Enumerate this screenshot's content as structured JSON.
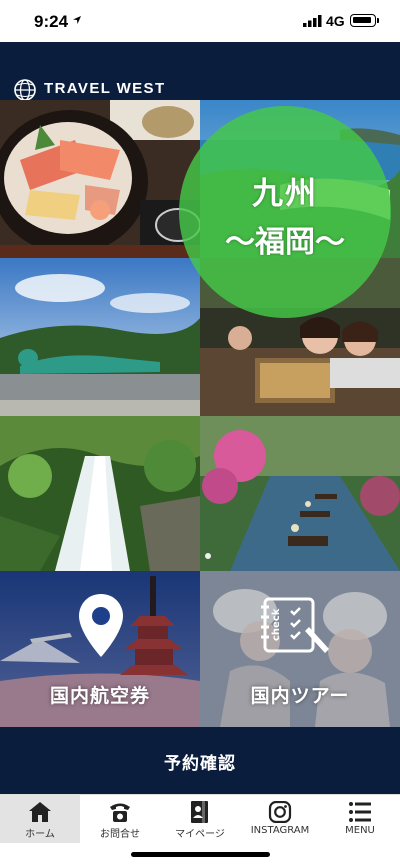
{
  "status_bar": {
    "time": "9:24",
    "network": "4G"
  },
  "header": {
    "logo_text": "TRAVEL WEST"
  },
  "hero": {
    "region_line1": "九州",
    "region_line2": "～福岡～"
  },
  "actions": {
    "domestic_air": "国内航空券",
    "domestic_tour": "国内ツアー",
    "check_text": "check"
  },
  "reserve": {
    "label": "予約確認"
  },
  "tabbar": {
    "items": [
      {
        "label": "ホーム",
        "icon": "home-icon"
      },
      {
        "label": "お問合せ",
        "icon": "phone-icon"
      },
      {
        "label": "マイページ",
        "icon": "mypage-icon"
      },
      {
        "label": "INSTAGRAM",
        "icon": "instagram-icon"
      },
      {
        "label": "MENU",
        "icon": "menu-icon"
      }
    ]
  },
  "colors": {
    "header_navy": "#0b1d3c",
    "region_green": "#44c848"
  }
}
